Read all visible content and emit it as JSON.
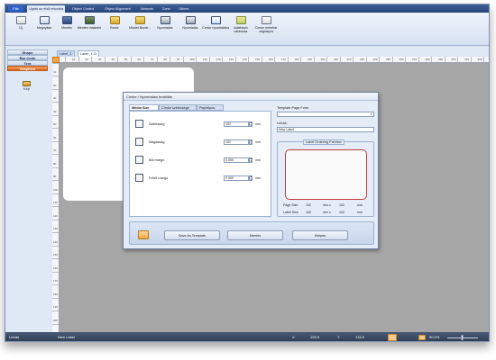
{
  "ribbon_tabs": [
    "File",
    "Ugrás az első rekordra",
    "Object Control",
    "Object Alignment",
    "Network",
    "Zone",
    "Others"
  ],
  "ribbon_buttons": [
    {
      "label": "Új",
      "icon": "new-document-icon"
    },
    {
      "label": "Megnyitás",
      "icon": "open-icon"
    },
    {
      "label": "Mentés",
      "icon": "save-icon"
    },
    {
      "label": "Mentés másként",
      "icon": "save-as-icon"
    },
    {
      "label": "Bezár",
      "icon": "close-folder-icon"
    },
    {
      "label": "Mindet Bezár...",
      "icon": "close-all-icon"
    },
    {
      "label": "Nyomtatás",
      "icon": "print-icon"
    },
    {
      "label": "Nyomtatás",
      "icon": "print-icon"
    },
    {
      "label": "Címke nyomtatása",
      "icon": "label-print-icon"
    },
    {
      "label": "Adatbázis választás",
      "icon": "database-icon"
    },
    {
      "label": "Címke mérettár vágólapra",
      "icon": "clipboard-icon"
    }
  ],
  "left_panel": {
    "items": [
      "Shape",
      "Bar Code",
      "Text",
      "Graphics"
    ],
    "active_index": 3,
    "tool_label": "Kép"
  },
  "doc_tabs": [
    "Label_1",
    "Label_1 Cí"
  ],
  "ruler_numbers": [
    "10",
    "20",
    "30",
    "40",
    "50",
    "60",
    "70",
    "80",
    "90",
    "100",
    "110",
    "120",
    "130",
    "140",
    "150",
    "160",
    "170",
    "180",
    "190",
    "200",
    "210",
    "220",
    "230",
    "240",
    "250",
    "260",
    "270",
    "280",
    "290",
    "300",
    "310",
    "320"
  ],
  "vruler_numbers": [
    "10",
    "20",
    "30",
    "40",
    "50",
    "60",
    "70",
    "80",
    "90",
    "100",
    "110",
    "120",
    "130",
    "140",
    "150",
    "160",
    "170",
    "180",
    "190",
    "200"
  ],
  "dialog": {
    "title": "Címke / Nyomtatási beállítás",
    "tabs": [
      "Média Size",
      "Címke szélessége",
      "Papírtípus"
    ],
    "rows": [
      {
        "label": "Szélesség",
        "value": "102",
        "unit": "mm"
      },
      {
        "label": "Magasság",
        "value": "102",
        "unit": "mm"
      },
      {
        "label": "Bal margó",
        "value": "0.000",
        "unit": "mm"
      },
      {
        "label": "Felső margó",
        "value": "0.000",
        "unit": "mm"
      }
    ],
    "template_page_form_label": "Template Page Form",
    "label_field_label": "Leírás:",
    "label_field_value": "New Label",
    "preview_title": "Label Ordering Preview",
    "page_size": {
      "label": "Page Size",
      "w": "102",
      "x": "mm  x",
      "h": "102",
      "unit": "mm"
    },
    "label_size": {
      "label": "Label Size",
      "w": "102",
      "x": "mm  x",
      "h": "102",
      "unit": "mm"
    },
    "small_button_label": "····",
    "buttons": [
      "Save As Template",
      "Mentés",
      "Kilépés"
    ]
  },
  "status": {
    "left_label": "Leírás",
    "doc_name": "New Label",
    "x_label": "X",
    "x_value": "155.5",
    "y_label": "Y",
    "y_value": "134.5",
    "zoom": "50.0%"
  }
}
